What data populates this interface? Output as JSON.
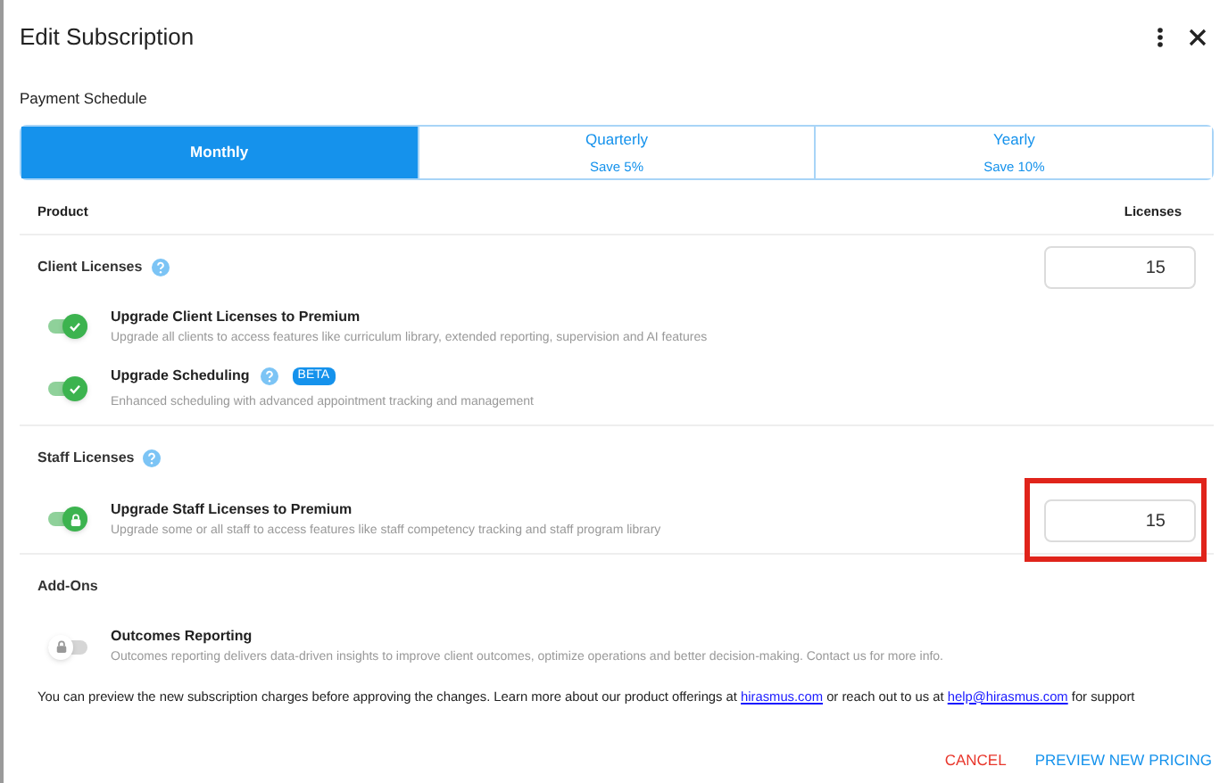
{
  "dialog": {
    "title": "Edit Subscription"
  },
  "payment_schedule": {
    "label": "Payment Schedule",
    "tabs": [
      {
        "label": "Monthly",
        "selected": true
      },
      {
        "label": "Quarterly",
        "sublabel": "Save 5%",
        "selected": false
      },
      {
        "label": "Yearly",
        "sublabel": "Save 10%",
        "selected": false
      }
    ]
  },
  "table": {
    "columns": [
      "Product",
      "Licenses"
    ],
    "sections": [
      {
        "title": "Client Licenses",
        "help": true,
        "licenses": "15",
        "items": [
          {
            "name": "Upgrade Client Licenses to Premium",
            "description": "Upgrade all clients to access features like curriculum library, extended reporting, supervision and AI features",
            "on": true,
            "locked": false
          },
          {
            "name": "Upgrade Scheduling",
            "description": "Enhanced scheduling with advanced appointment tracking and management",
            "on": true,
            "locked": false,
            "help": true,
            "badge": "BETA"
          }
        ]
      },
      {
        "title": "Staff Licenses",
        "help": true,
        "items": [
          {
            "name": "Upgrade Staff Licenses to Premium",
            "description": "Upgrade some or all staff to access features like staff competency tracking and staff program library",
            "on": true,
            "locked": true,
            "licenses": "15",
            "highlighted": true
          }
        ]
      },
      {
        "title": "Add-Ons",
        "items": [
          {
            "name": "Outcomes Reporting",
            "description": "Outcomes reporting delivers data-driven insights to improve client outcomes, optimize operations and better decision-making. Contact us for more info.",
            "on": false,
            "locked": true
          }
        ]
      }
    ]
  },
  "note": {
    "before": "You can preview the new subscription charges before approving the changes. Learn more about our product offerings at ",
    "link1": "hirasmus.com",
    "middle": " or reach out to us at ",
    "link2": "help@hirasmus.com",
    "after": " for support"
  },
  "actions": {
    "cancel": "CANCEL",
    "confirm": "PREVIEW NEW PRICING"
  }
}
